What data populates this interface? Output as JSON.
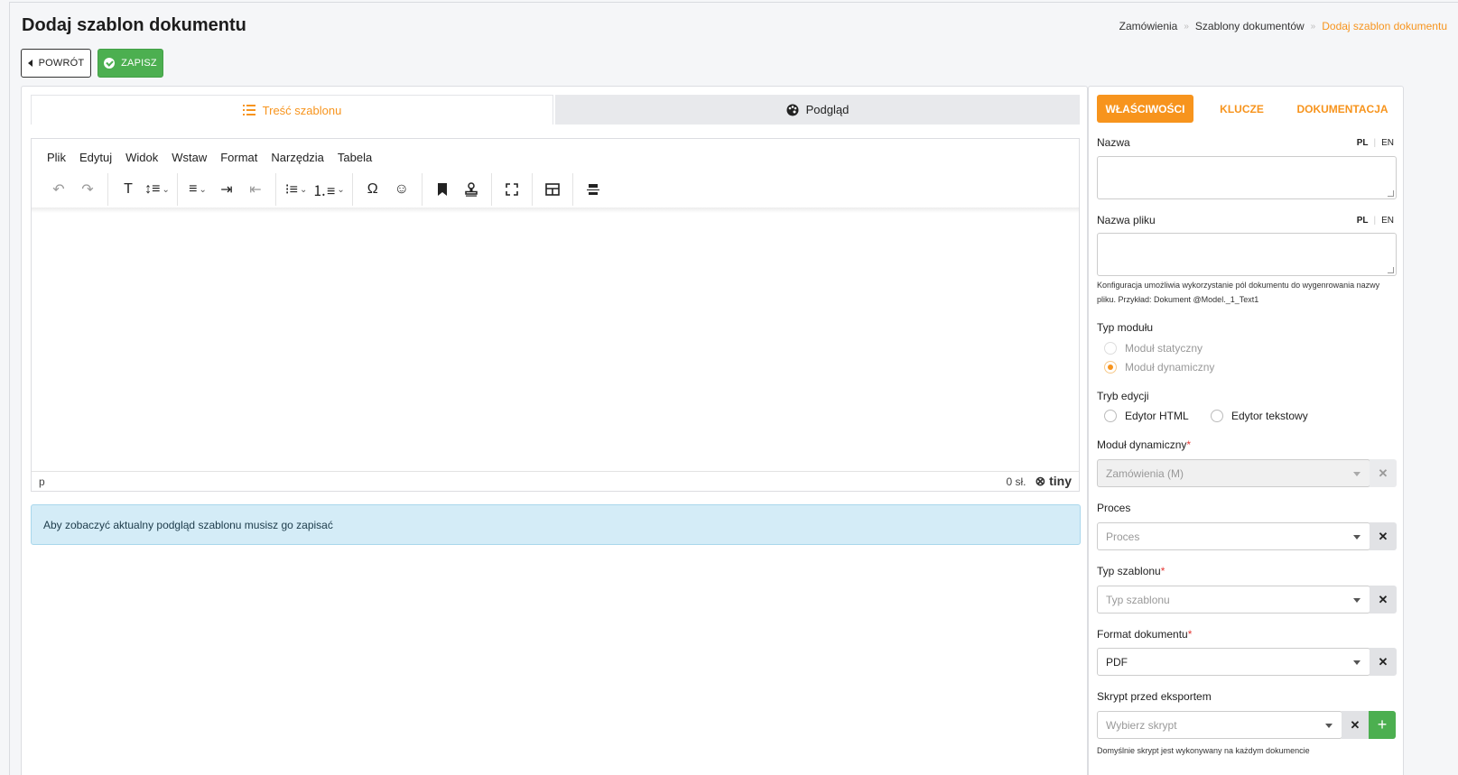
{
  "page": {
    "title": "Dodaj szablon dokumentu",
    "breadcrumb": [
      "Zamówienia",
      "Szablony dokumentów",
      "Dodaj szablon dokumentu"
    ],
    "breadcrumb_separator": "»",
    "back_label": "POWRÓT",
    "save_label": "ZAPISZ"
  },
  "colors": {
    "accent": "#f7941d",
    "success": "#4caf50",
    "info_bg": "#d4ecf7",
    "required": "#e53935"
  },
  "main": {
    "tabs": [
      {
        "label": "Treść szablonu",
        "icon": "list-icon",
        "active": true
      },
      {
        "label": "Podgląd",
        "icon": "palette-icon",
        "active": false
      }
    ],
    "editor": {
      "menu": [
        "Plik",
        "Edytuj",
        "Widok",
        "Wstaw",
        "Format",
        "Narzędzia",
        "Tabela"
      ],
      "status_path": "p",
      "word_count": "0 sł.",
      "brand": "tiny"
    },
    "alert": "Aby zobaczyć aktualny podgląd szablonu musisz go zapisać"
  },
  "side": {
    "tabs": [
      "WŁAŚCIWOŚCI",
      "KLUCZE",
      "DOKUMENTACJA"
    ],
    "lang": {
      "pl": "PL",
      "en": "EN"
    },
    "name_label": "Nazwa",
    "filename_label": "Nazwa pliku",
    "filename_hint": "Konfiguracja umożliwia wykorzystanie pól dokumentu do wygenrowania nazwy pliku. Przykład: Dokument @Model._1_Text1",
    "module_type_label": "Typ modułu",
    "module_types": [
      "Moduł statyczny",
      "Moduł dynamiczny"
    ],
    "edit_mode_label": "Tryb edycji",
    "edit_modes": [
      "Edytor HTML",
      "Edytor tekstowy"
    ],
    "dynamic_module_label": "Moduł dynamiczny",
    "dynamic_module_value": "Zamówienia (M)",
    "process_label": "Proces",
    "process_placeholder": "Proces",
    "template_type_label": "Typ szablonu",
    "template_type_placeholder": "Typ szablonu",
    "doc_format_label": "Format dokumentu",
    "doc_format_value": "PDF",
    "script_label": "Skrypt przed eksportem",
    "script_placeholder": "Wybierz skrypt",
    "script_hint": "Domyślnie skrypt jest wykonywany na każdym dokumencie",
    "required_mark": "*",
    "clear_symbol": "✕",
    "add_symbol": "+"
  }
}
